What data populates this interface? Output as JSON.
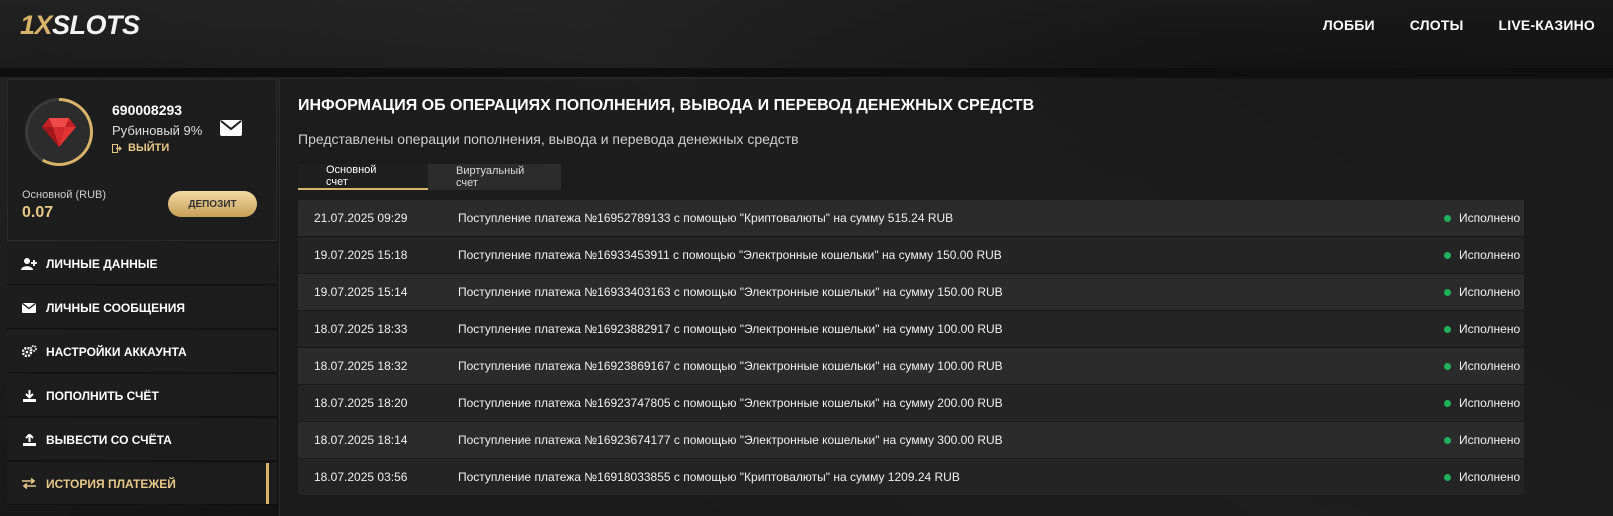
{
  "brand": {
    "logo_part1": "1X",
    "logo_part2": "SLOTS"
  },
  "nav": {
    "items": [
      "ЛОББИ",
      "СЛОТЫ",
      "LIVE-КАЗИНО"
    ]
  },
  "profile": {
    "user_id": "690008293",
    "level": "Рубиновый 9%",
    "logout_label": "ВЫЙТИ",
    "balance_label": "Основной (RUB)",
    "balance_value": "0.07",
    "deposit_label": "ДЕПОЗИТ"
  },
  "menu": {
    "items": [
      {
        "label": "ЛИЧНЫЕ ДАННЫЕ",
        "icon": "user-plus-icon"
      },
      {
        "label": "ЛИЧНЫЕ СООБЩЕНИЯ",
        "icon": "envelope-icon"
      },
      {
        "label": "НАСТРОЙКИ АККАУНТА",
        "icon": "gears-icon"
      },
      {
        "label": "ПОПОЛНИТЬ СЧЁТ",
        "icon": "download-icon"
      },
      {
        "label": "ВЫВЕСТИ СО СЧЁТА",
        "icon": "upload-icon"
      },
      {
        "label": "ИСТОРИЯ ПЛАТЕЖЕЙ",
        "icon": "exchange-icon",
        "active": true
      }
    ]
  },
  "main": {
    "title": "ИНФОРМАЦИЯ ОБ ОПЕРАЦИЯХ ПОПОЛНЕНИЯ, ВЫВОДА И ПЕРЕВОД ДЕНЕЖНЫХ СРЕДСТВ",
    "subtitle": "Представлены операции пополнения, вывода и перевода денежных средств",
    "tabs": [
      "Основной счет",
      "Виртуальный счет"
    ],
    "rows": [
      {
        "date": "21.07.2025 09:29",
        "desc": "Поступление платежа №16952789133 с помощью \"Криптовалюты\" на сумму 515.24 RUB",
        "status": "Исполнено"
      },
      {
        "date": "19.07.2025 15:18",
        "desc": "Поступление платежа №16933453911 с помощью \"Электронные кошельки\" на сумму 150.00 RUB",
        "status": "Исполнено"
      },
      {
        "date": "19.07.2025 15:14",
        "desc": "Поступление платежа №16933403163 с помощью \"Электронные кошельки\" на сумму 150.00 RUB",
        "status": "Исполнено"
      },
      {
        "date": "18.07.2025 18:33",
        "desc": "Поступление платежа №16923882917 с помощью \"Электронные кошельки\" на сумму 100.00 RUB",
        "status": "Исполнено"
      },
      {
        "date": "18.07.2025 18:32",
        "desc": "Поступление платежа №16923869167 с помощью \"Электронные кошельки\" на сумму 100.00 RUB",
        "status": "Исполнено"
      },
      {
        "date": "18.07.2025 18:20",
        "desc": "Поступление платежа №16923747805 с помощью \"Электронные кошельки\" на сумму 200.00 RUB",
        "status": "Исполнено"
      },
      {
        "date": "18.07.2025 18:14",
        "desc": "Поступление платежа №16923674177 с помощью \"Электронные кошельки\" на сумму 300.00 RUB",
        "status": "Исполнено"
      },
      {
        "date": "18.07.2025 03:56",
        "desc": "Поступление платежа №16918033855 с помощью \"Криптовалюты\" на сумму 1209.24 RUB",
        "status": "Исполнено"
      }
    ]
  },
  "colors": {
    "accent": "#d9b36a",
    "status_ok": "#1fb15a",
    "ruby": "#d0282b"
  }
}
